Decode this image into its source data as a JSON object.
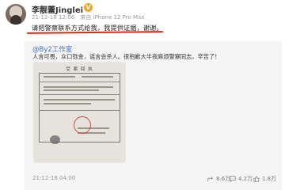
{
  "post": {
    "username": "李靓蕾Jinglei",
    "badge_glyph": "V",
    "date": "21-12-18 12:06",
    "source": "来自 iPhone 12 Pro Max",
    "text": "请把警察联系方式给我，我提供证据，谢谢。"
  },
  "repost": {
    "author": "@By2工作室",
    "text": "人言可畏，众口铄金，谣言会杀人。很抱歉大半夜麻烦警察同志，辛苦了！",
    "document_title": "受 案 回 执",
    "time": "21-12-18 04:00",
    "stats": {
      "shares": "8.6万",
      "comments": "4.2万",
      "likes": "1.8万"
    }
  },
  "colors": {
    "highlight_line": "#e0241c",
    "link": "#3d6ec2",
    "badge": "#f0a422"
  }
}
